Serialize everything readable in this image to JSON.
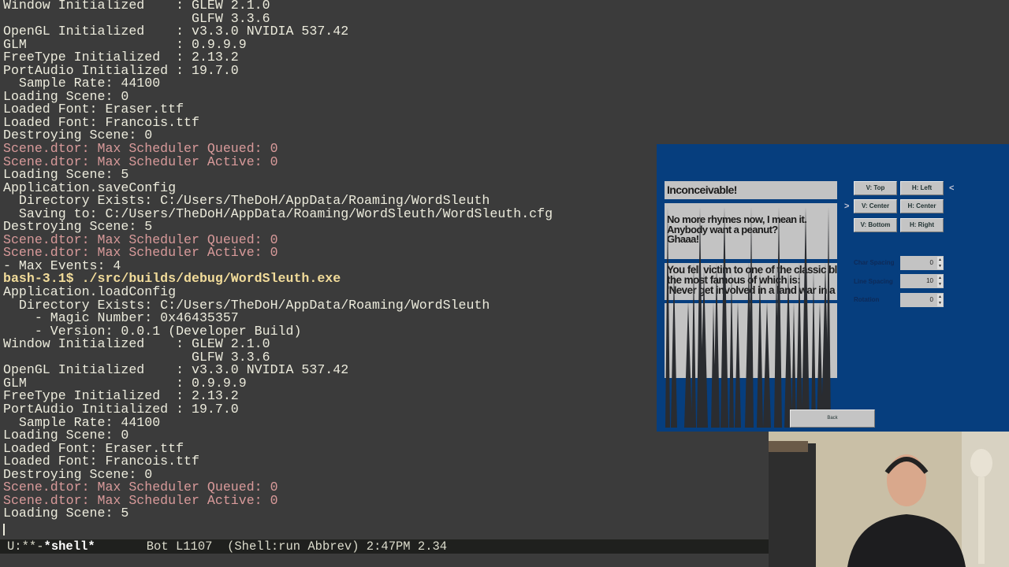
{
  "terminal": {
    "lines": [
      {
        "t": "Window Initialized    : GLEW 2.1.0",
        "k": "n"
      },
      {
        "t": "                        GLFW 3.3.6",
        "k": "n"
      },
      {
        "t": "OpenGL Initialized    : v3.3.0 NVIDIA 537.42",
        "k": "n"
      },
      {
        "t": "GLM                   : 0.9.9.9",
        "k": "n"
      },
      {
        "t": "FreeType Initialized  : 2.13.2",
        "k": "n"
      },
      {
        "t": "PortAudio Initialized : 19.7.0",
        "k": "n"
      },
      {
        "t": "  Sample Rate: 44100",
        "k": "n"
      },
      {
        "t": "Loading Scene: 0",
        "k": "n"
      },
      {
        "t": "Loaded Font: Eraser.ttf",
        "k": "n"
      },
      {
        "t": "Loaded Font: Francois.ttf",
        "k": "n"
      },
      {
        "t": "Destroying Scene: 0",
        "k": "n"
      },
      {
        "t": "Scene.dtor: Max Scheduler Queued: 0",
        "k": "red"
      },
      {
        "t": "Scene.dtor: Max Scheduler Active: 0",
        "k": "red"
      },
      {
        "t": "Loading Scene: 5",
        "k": "n"
      },
      {
        "t": "Application.saveConfig",
        "k": "n"
      },
      {
        "t": "  Directory Exists: C:/Users/TheDoH/AppData/Roaming/WordSleuth",
        "k": "n"
      },
      {
        "t": "  Saving to: C:/Users/TheDoH/AppData/Roaming/WordSleuth/WordSleuth.cfg",
        "k": "n"
      },
      {
        "t": "Destroying Scene: 5",
        "k": "n"
      },
      {
        "t": "Scene.dtor: Max Scheduler Queued: 0",
        "k": "red"
      },
      {
        "t": "Scene.dtor: Max Scheduler Active: 0",
        "k": "red"
      },
      {
        "t": "- Max Events: 4",
        "k": "n"
      },
      {
        "t": "bash-3.1$ ./src/builds/debug/WordSleuth.exe",
        "k": "prompt"
      },
      {
        "t": "Application.loadConfig",
        "k": "n"
      },
      {
        "t": "  Directory Exists: C:/Users/TheDoH/AppData/Roaming/WordSleuth",
        "k": "n"
      },
      {
        "t": "    - Magic Number: 0x46435357",
        "k": "n"
      },
      {
        "t": "    - Version: 0.0.1 (Developer Build)",
        "k": "n"
      },
      {
        "t": "Window Initialized    : GLEW 2.1.0",
        "k": "n"
      },
      {
        "t": "                        GLFW 3.3.6",
        "k": "n"
      },
      {
        "t": "OpenGL Initialized    : v3.3.0 NVIDIA 537.42",
        "k": "n"
      },
      {
        "t": "GLM                   : 0.9.9.9",
        "k": "n"
      },
      {
        "t": "FreeType Initialized  : 2.13.2",
        "k": "n"
      },
      {
        "t": "PortAudio Initialized : 19.7.0",
        "k": "n"
      },
      {
        "t": "  Sample Rate: 44100",
        "k": "n"
      },
      {
        "t": "Loading Scene: 0",
        "k": "n"
      },
      {
        "t": "Loaded Font: Eraser.ttf",
        "k": "n"
      },
      {
        "t": "Loaded Font: Francois.ttf",
        "k": "n"
      },
      {
        "t": "Destroying Scene: 0",
        "k": "n"
      },
      {
        "t": "Scene.dtor: Max Scheduler Queued: 0",
        "k": "red"
      },
      {
        "t": "Scene.dtor: Max Scheduler Active: 0",
        "k": "red"
      },
      {
        "t": "Loading Scene: 5",
        "k": "n"
      }
    ]
  },
  "status": {
    "mode": "U:**-",
    "buffer": "*shell*",
    "rest": "       Bot L1107  (Shell:run Abbrev) 2:47PM 2.34"
  },
  "game": {
    "title_text": "Inconceivable!",
    "text2": "No more rhymes now, I mean it.\nAnybody want a peanut?\nGhaaa!",
    "text3": "You fell victim to one of the classic bl\nthe most famous of which is:\n'Never get involved in a land war in a",
    "buttons": {
      "v_top": "V: Top",
      "h_left": "H: Left",
      "v_center": "V: Center",
      "h_center": "H: Center",
      "v_bottom": "V: Bottom",
      "h_right": "H: Right"
    },
    "left_marker": ">",
    "right_marker": "<",
    "char_spacing_label": "Char Spacing",
    "char_spacing": "0",
    "line_spacing_label": "Line Spacing",
    "line_spacing": "10",
    "rotation_label": "Rotation",
    "rotation": "0",
    "back": "Back",
    "colors": {
      "bg": "#063e7e",
      "panel": "#c3c3c3"
    }
  }
}
